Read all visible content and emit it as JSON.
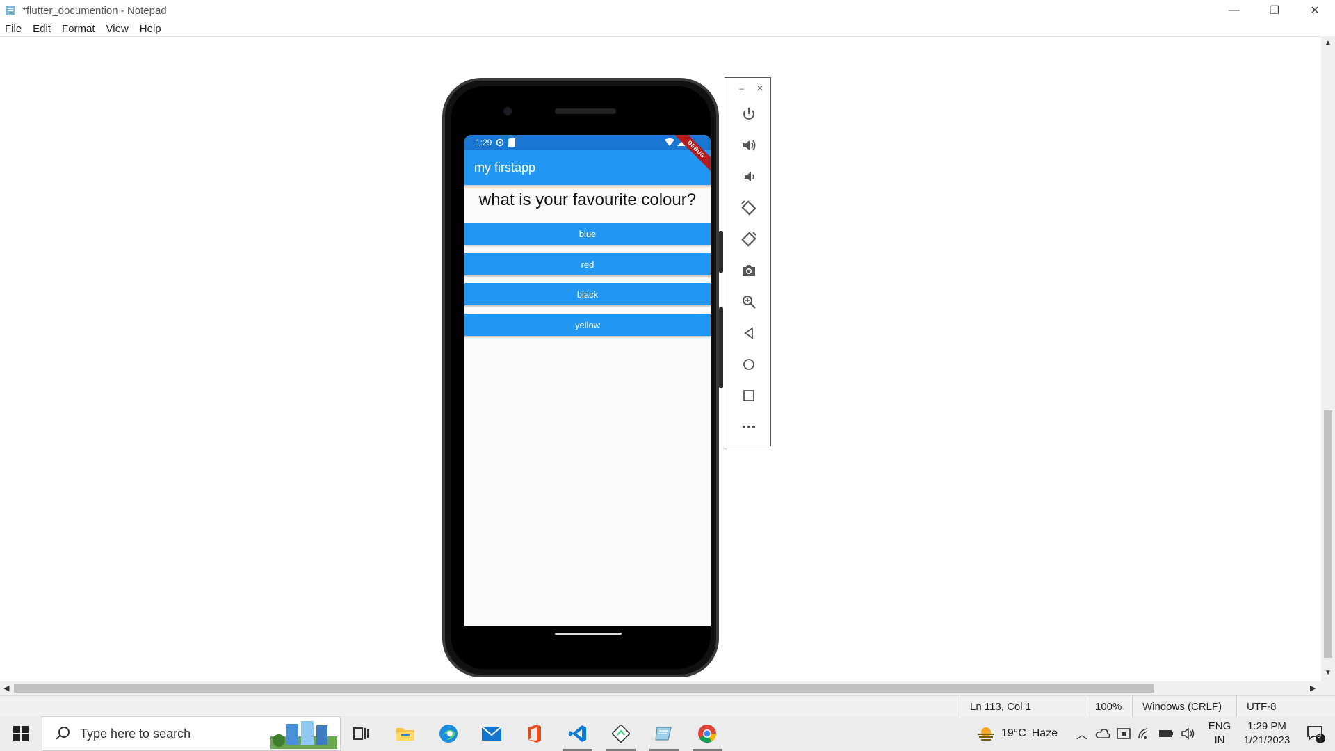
{
  "window": {
    "title": "*flutter_documention - Notepad",
    "minimize_glyph": "—",
    "restore_glyph": "❐",
    "close_glyph": "✕"
  },
  "menu": [
    "File",
    "Edit",
    "Format",
    "View",
    "Help"
  ],
  "status_bar": {
    "position": "Ln 113, Col 1",
    "zoom": "100%",
    "line_ending": "Windows (CRLF)",
    "encoding": "UTF-8"
  },
  "emulator": {
    "toolbar_minimize": "–",
    "toolbar_close": "✕",
    "buttons": [
      "power-icon",
      "volume-up-icon",
      "volume-down-icon",
      "rotate-left-icon",
      "rotate-right-icon",
      "camera-icon",
      "zoom-icon",
      "back-icon",
      "home-icon",
      "overview-icon",
      "more-icon"
    ]
  },
  "phone": {
    "status_time": "1:29",
    "app_title": "my firstapp",
    "debug_label": "DEBUG",
    "question": "what is your favourite colour?",
    "answers": [
      "blue",
      "red",
      "black",
      "yellow"
    ]
  },
  "taskbar": {
    "search_placeholder": "Type here to search",
    "weather_temp": "19°C",
    "weather_desc": "Haze",
    "language": "ENG",
    "region": "IN",
    "time": "1:29 PM",
    "date": "1/21/2023",
    "notification_count": "9"
  },
  "colors": {
    "app_bar": "#2196f3",
    "status_bar": "#1976d2",
    "debug_banner": "#b71c1c"
  }
}
